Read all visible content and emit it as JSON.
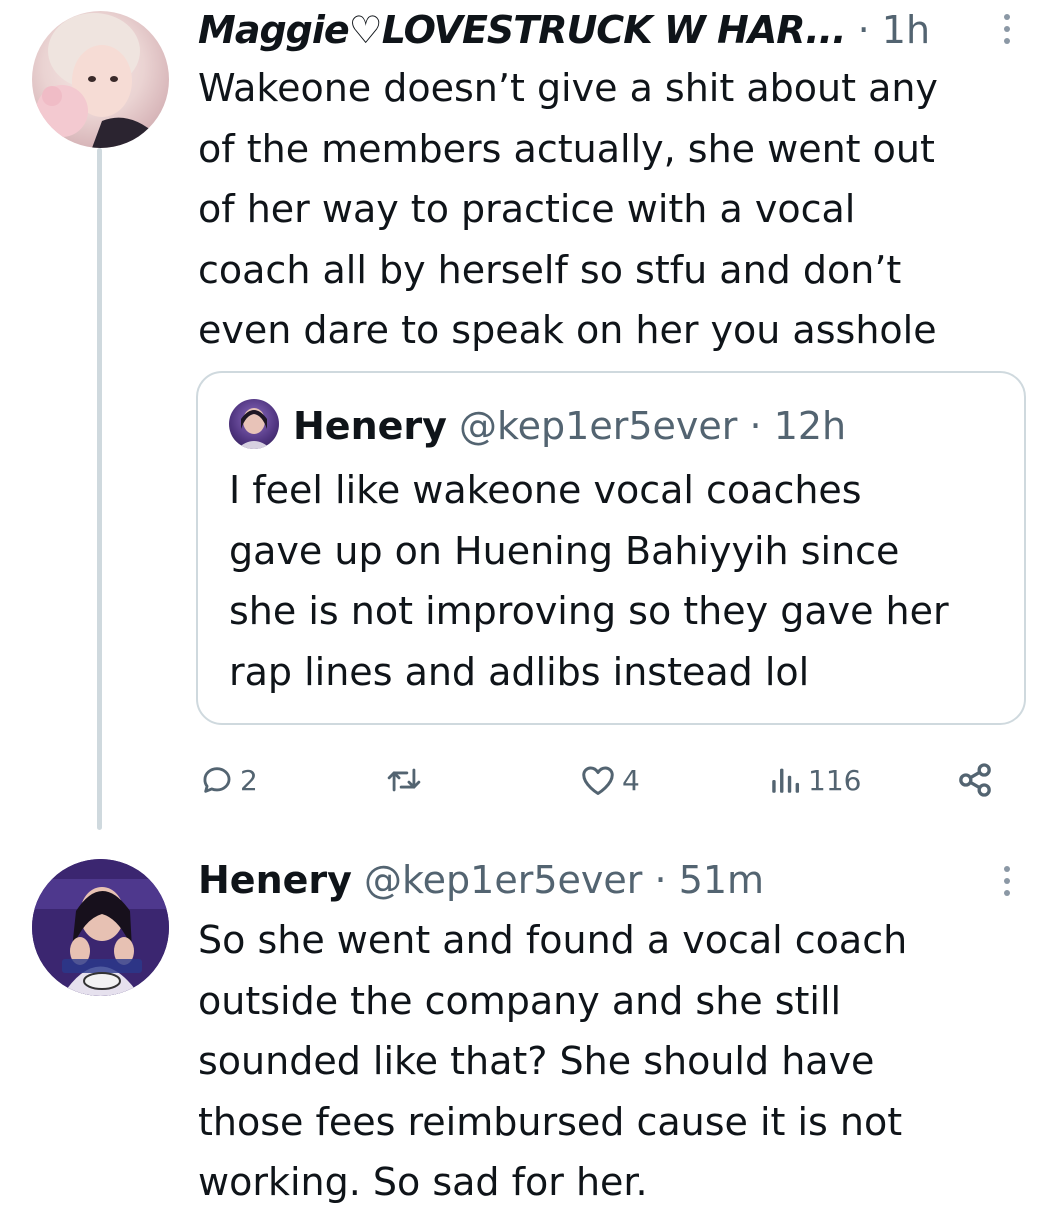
{
  "tweet1": {
    "display_name": "Maggie♡LOVESTRUCK W HAR...",
    "separator": "·",
    "time": "1h",
    "text_lines": [
      "Wakeone doesn’t give a shit about any",
      "of the members actually, she went out",
      "of her way to practice with a vocal",
      "coach all by herself so stfu and don’t",
      "even dare to speak on her you asshole"
    ],
    "quote": {
      "display_name": "Henery",
      "handle": "@kep1er5ever",
      "separator": "·",
      "time": "12h",
      "text_lines": [
        "I feel like wakeone vocal coaches",
        "gave up on Huening Bahiyyih since",
        "she is not improving so they gave her",
        "rap lines and adlibs instead lol"
      ]
    },
    "actions": {
      "reply_count": "2",
      "retweet_count": "",
      "like_count": "4",
      "view_count": "116"
    }
  },
  "tweet2": {
    "display_name": "Henery",
    "handle": "@kep1er5ever",
    "separator": "·",
    "time": "51m",
    "text_lines": [
      "So she went and found a vocal coach",
      "outside the company and she still",
      "sounded like that? She should have",
      "those fees reimbursed cause it is not",
      "working. So sad for her."
    ]
  },
  "icons": {
    "reply": "reply-icon",
    "retweet": "retweet-icon",
    "like": "heart-icon",
    "views": "views-icon",
    "share": "share-icon",
    "more": "more-icon"
  },
  "colors": {
    "text": "#0f1419",
    "secondary": "#536471",
    "border": "#cfd9de"
  }
}
